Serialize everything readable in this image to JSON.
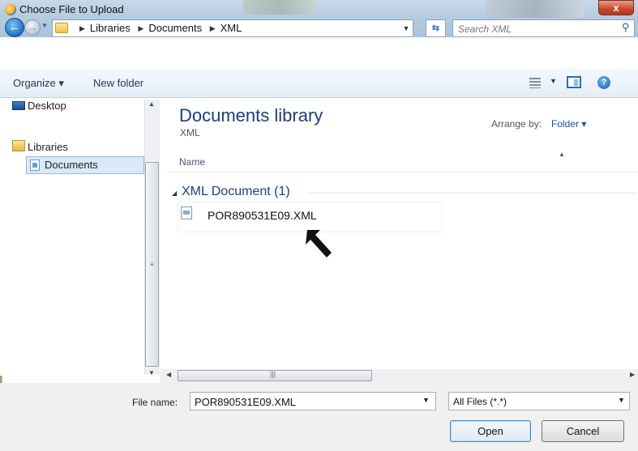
{
  "window": {
    "title": "Choose File to Upload",
    "close_glyph": "x"
  },
  "nav": {
    "back_glyph": "←",
    "forward_glyph": "→",
    "breadcrumb": [
      "Libraries",
      "Documents",
      "XML"
    ],
    "refresh_glyph": "⇆",
    "search_placeholder": "Search XML"
  },
  "toolbar": {
    "organize_label": "Organize ▾",
    "new_folder_label": "New folder",
    "help_glyph": "?"
  },
  "sidebar": {
    "items": [
      {
        "label": "Desktop"
      },
      {
        "label": "Libraries"
      },
      {
        "label": "Documents",
        "selected": true
      }
    ]
  },
  "library": {
    "title": "Documents library",
    "subtitle": "XML",
    "arrange_label": "Arrange by:",
    "arrange_value": "Folder ▾",
    "column_name": "Name",
    "group_label": "XML Document (1)",
    "files": [
      {
        "name": "POR890531E09.XML"
      }
    ]
  },
  "footer": {
    "file_name_label": "File name:",
    "file_name_value": "POR890531E09.XML",
    "file_type_value": "All Files (*.*)",
    "open_label": "Open",
    "cancel_label": "Cancel"
  },
  "colors": {
    "title_blue": "#1e3d7a",
    "selection": "#dbe8f7",
    "glass": "#b6cde0"
  }
}
